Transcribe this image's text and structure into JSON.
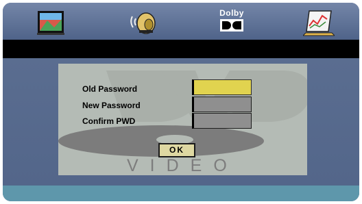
{
  "menu_tabs": [
    {
      "icon": "tv-screen-icon"
    },
    {
      "icon": "speaker-icon"
    },
    {
      "label": "Dolby",
      "icon": "dolby-logo-icon"
    },
    {
      "icon": "preferences-chart-icon"
    }
  ],
  "password_form": {
    "fields": [
      {
        "label": "Old Password",
        "value": "",
        "state": "selected"
      },
      {
        "label": "New Password",
        "value": ""
      },
      {
        "label": "Confirm PWD",
        "value": ""
      }
    ],
    "ok_label": "OK"
  },
  "background_logo": {
    "text": "VIDEO",
    "logo_letters": "DVD"
  },
  "colors": {
    "top_bar": "#5c6f93",
    "panel": "#b4bbb5",
    "field": "#8f8f8f",
    "field_selected": "#e1d34f",
    "ok_button": "#ded8a2",
    "bottom_bar": "#5e97ab"
  }
}
